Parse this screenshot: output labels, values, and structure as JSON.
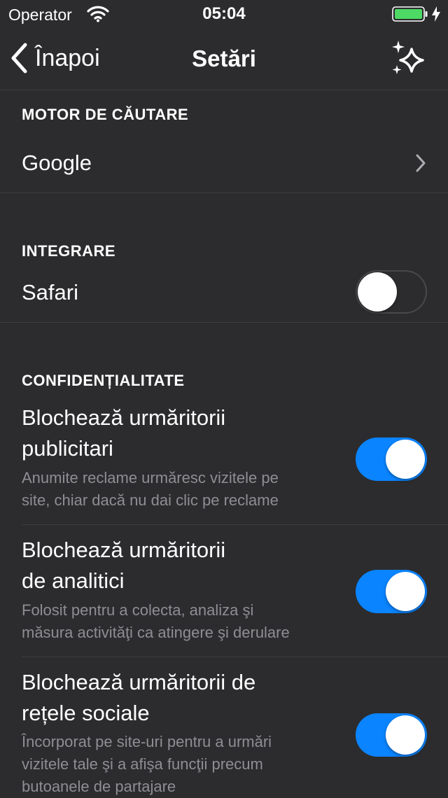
{
  "status_bar": {
    "operator": "Operator",
    "time": "05:04",
    "battery_level": 1.0
  },
  "nav": {
    "back_label": "Înapoi",
    "title": "Setări"
  },
  "sections": {
    "search_engine": {
      "header": "MOTOR DE CĂUTARE",
      "value": "Google"
    },
    "integration": {
      "header": "INTEGRARE",
      "safari_label": "Safari",
      "safari_enabled": false
    },
    "privacy": {
      "header": "CONFIDENȚIALITATE",
      "items": [
        {
          "title_line1": "Blochează urmăritorii",
          "title_line2": "publicitari",
          "sub_line1": "Anumite reclame urmăresc vizitele pe",
          "sub_line2": "site, chiar dacă nu dai clic pe reclame",
          "sub_line3": "",
          "enabled": true
        },
        {
          "title_line1": "Blochează urmăritorii",
          "title_line2": "de analitici",
          "sub_line1": "Folosit pentru a colecta, analiza şi",
          "sub_line2": "măsura activităţi ca atingere şi derulare",
          "sub_line3": "",
          "enabled": true
        },
        {
          "title_line1": "Blochează urmăritorii de",
          "title_line2": "rețele sociale",
          "sub_line1": "Încorporat pe site-uri pentru a urmări",
          "sub_line2": "vizitele tale şi a afişa funcţii precum",
          "sub_line3": "butoanele de partajare",
          "enabled": true
        }
      ]
    }
  },
  "colors": {
    "background": "#2c2c2e",
    "accent": "#0a84ff",
    "secondary_text": "#8e8e93",
    "battery": "#4cd964"
  },
  "icons": {
    "back": "chevron-left-icon",
    "sparkle": "sparkles-icon",
    "disclosure": "chevron-right-icon",
    "wifi": "wifi-icon",
    "battery": "battery-icon",
    "charging": "charging-bolt-icon"
  }
}
